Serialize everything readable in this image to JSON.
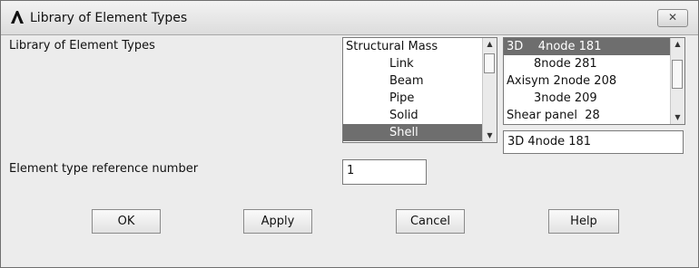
{
  "window": {
    "title": "Library of Element Types",
    "close_label": "✕"
  },
  "library_label": "Library of Element Types",
  "category_list": {
    "items": [
      "Structural Mass",
      "Link",
      "Beam",
      "Pipe",
      "Solid",
      "Shell"
    ],
    "selected": "Shell"
  },
  "type_list": {
    "items": [
      "3D    4node 181",
      "8node 281",
      "Axisym 2node 208",
      "3node 209",
      "Shear panel  28"
    ],
    "selected": "3D    4node 181"
  },
  "type_selected_value": "3D    4node 181",
  "ref_label": "Element type reference number",
  "ref_value": "1",
  "buttons": {
    "ok": "OK",
    "apply": "Apply",
    "cancel": "Cancel",
    "help": "Help"
  },
  "colors": {
    "selection": "#6e6e6e",
    "dialog_bg": "#ececec"
  }
}
